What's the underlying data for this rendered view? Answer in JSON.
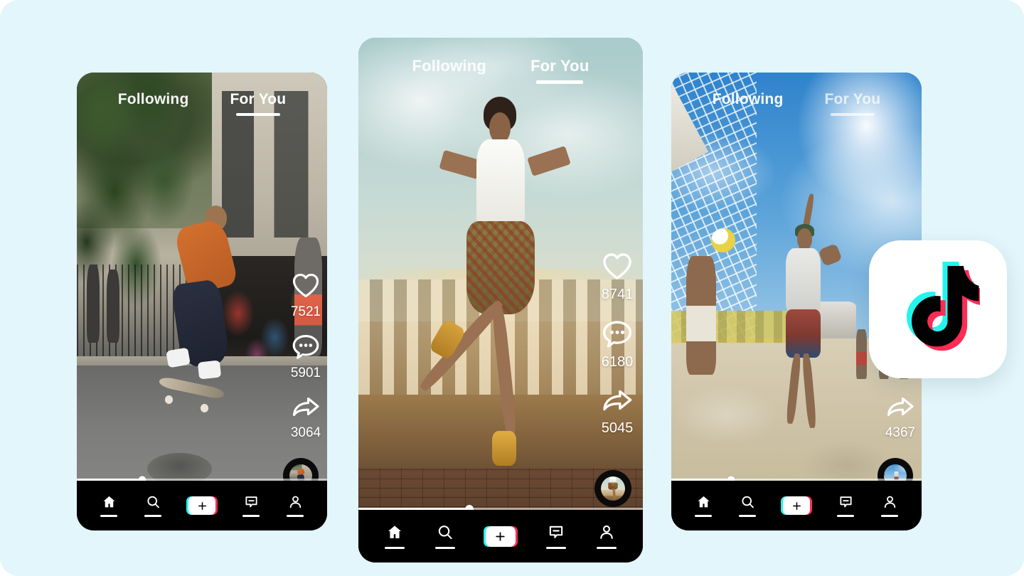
{
  "page": {
    "background_color": "#e2f6fb",
    "title": "TikTok mobile feed mockup"
  },
  "brand": {
    "name": "TikTok",
    "logo_icon": "tiktok-note-logo",
    "cyan": "#25f4ee",
    "pink": "#fe2c55",
    "black": "#010101",
    "white": "#ffffff"
  },
  "tabs": {
    "following_label": "Following",
    "foryou_label": "For You",
    "active": "For You"
  },
  "nav": {
    "items": [
      {
        "name": "home",
        "icon": "home-icon",
        "label": "Home"
      },
      {
        "name": "discover",
        "icon": "search-icon",
        "label": "Discover"
      },
      {
        "name": "create",
        "icon": "plus-icon",
        "label": "Create"
      },
      {
        "name": "inbox",
        "icon": "inbox-icon",
        "label": "Inbox"
      },
      {
        "name": "profile",
        "icon": "person-icon",
        "label": "Profile"
      }
    ]
  },
  "phones": [
    {
      "id": "phone-left",
      "scene": "street-skateboarder",
      "tabs": {
        "following_label": "Following",
        "foryou_label": "For You"
      },
      "actions": [
        {
          "name": "like",
          "icon": "heart-icon",
          "count": "7521"
        },
        {
          "name": "comment",
          "icon": "comment-icon",
          "count": "5901"
        },
        {
          "name": "share",
          "icon": "share-arrow-icon",
          "count": "3064"
        }
      ],
      "avatar": {
        "icon": "music-avatar-disc"
      },
      "progress": {
        "percent": 26
      }
    },
    {
      "id": "phone-center",
      "scene": "dancer-on-wall",
      "tabs": {
        "following_label": "Following",
        "foryou_label": "For You"
      },
      "actions": [
        {
          "name": "like",
          "icon": "heart-icon",
          "count": "8741"
        },
        {
          "name": "comment",
          "icon": "comment-icon",
          "count": "6180"
        },
        {
          "name": "share",
          "icon": "share-arrow-icon",
          "count": "5045"
        }
      ],
      "avatar": {
        "icon": "music-avatar-disc"
      },
      "progress": {
        "percent": 39
      }
    },
    {
      "id": "phone-right",
      "scene": "beach-volleyball",
      "tabs": {
        "following_label": "Following",
        "foryou_label": "For You"
      },
      "actions": [
        {
          "name": "like",
          "icon": "heart-icon",
          "count": ""
        },
        {
          "name": "comment",
          "icon": "comment-icon",
          "count": ""
        },
        {
          "name": "share",
          "icon": "share-arrow-icon",
          "count": "4367"
        }
      ],
      "avatar": {
        "icon": "music-avatar-disc"
      },
      "progress": {
        "percent": 24
      }
    }
  ]
}
